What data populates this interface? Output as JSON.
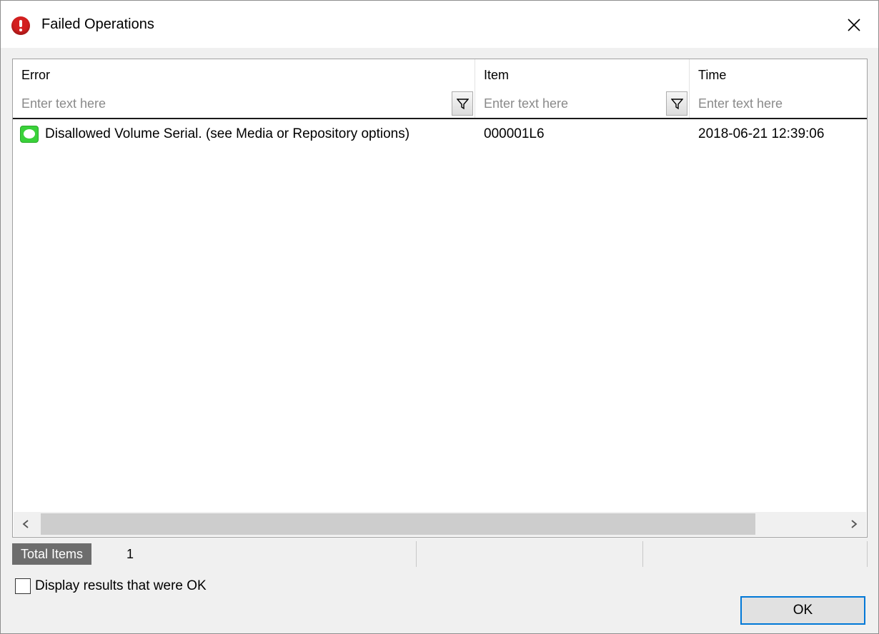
{
  "window": {
    "title": "Failed Operations",
    "icon": "error-icon",
    "close_icon": "close-icon"
  },
  "grid": {
    "columns": [
      {
        "label": "Error",
        "filter_placeholder": "Enter text here"
      },
      {
        "label": "Item",
        "filter_placeholder": "Enter text here"
      },
      {
        "label": "Time",
        "filter_placeholder": "Enter text here"
      }
    ],
    "rows": [
      {
        "icon": "message-icon",
        "error": "Disallowed Volume Serial. (see Media or Repository options)",
        "item": "000001L6",
        "time": "2018-06-21 12:39:06"
      }
    ]
  },
  "status": {
    "total_label": "Total Items",
    "total_value": "1"
  },
  "options": {
    "display_ok_label": "Display results that were OK",
    "display_ok_checked": false
  },
  "buttons": {
    "ok_label": "OK"
  },
  "colors": {
    "accent": "#0078d7",
    "error_icon": "#d41f1f",
    "row_icon": "#3ad13a",
    "status_label_bg": "#6d6d6d"
  }
}
